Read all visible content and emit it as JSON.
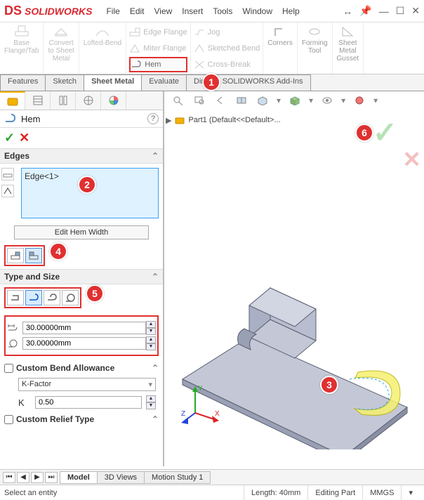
{
  "app": {
    "name": "SOLIDWORKS"
  },
  "menu": [
    "File",
    "Edit",
    "View",
    "Insert",
    "Tools",
    "Window",
    "Help"
  ],
  "ribbon": {
    "group1": {
      "base": "Base\nFlange/Tab",
      "convert": "Convert\nto Sheet\nMetal",
      "lofted": "Lofted-Bend"
    },
    "col1": {
      "edge_flange": "Edge Flange",
      "miter_flange": "Miter Flange",
      "hem": "Hem"
    },
    "col2": {
      "jog": "Jog",
      "sketched_bend": "Sketched Bend",
      "cross_break": "Cross-Break"
    },
    "group2": {
      "corners": "Corners",
      "forming": "Forming\nTool",
      "gusset": "Sheet\nMetal\nGusset"
    }
  },
  "tabs": [
    "Features",
    "Sketch",
    "Sheet Metal",
    "Evaluate",
    "Dim",
    "SOLIDWORKS Add-Ins"
  ],
  "active_tab": "Sheet Metal",
  "panel": {
    "feature_title": "Hem",
    "edges_header": "Edges",
    "edge_item": "Edge<1>",
    "edit_hem_width": "Edit Hem Width",
    "type_size_header": "Type and Size",
    "length_value": "30.00000mm",
    "radius_value": "30.00000mm",
    "custom_bend": "Custom Bend Allowance",
    "kfactor_label": "K-Factor",
    "k_sym": "K",
    "k_value": "0.50",
    "custom_relief": "Custom Relief Type"
  },
  "tree": {
    "part": "Part1 (Default<<Default>..."
  },
  "bottom_tabs": [
    "Model",
    "3D Views",
    "Motion Study 1"
  ],
  "status": {
    "prompt": "Select an entity",
    "length": "Length: 40mm",
    "mode": "Editing Part",
    "units": "MMGS"
  },
  "badges": {
    "b1": "1",
    "b2": "2",
    "b3": "3",
    "b4": "4",
    "b5": "5",
    "b6": "6"
  }
}
